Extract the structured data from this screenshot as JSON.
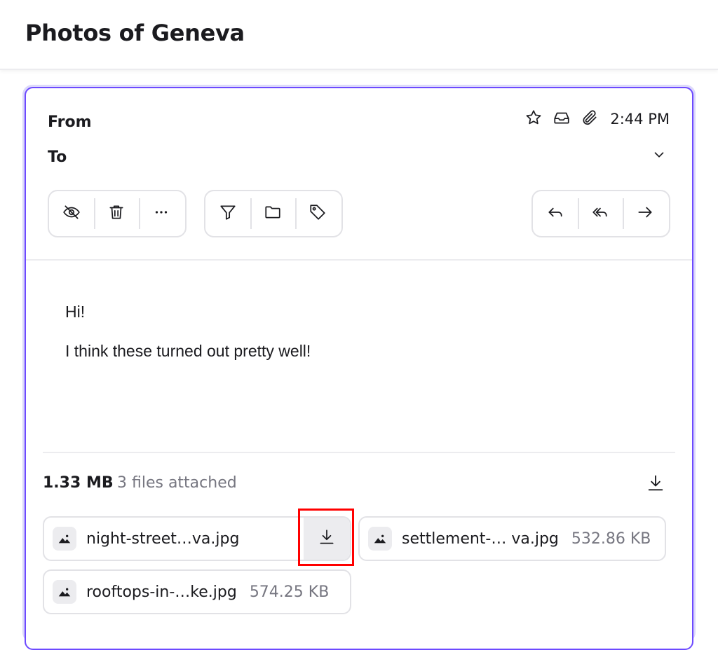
{
  "header": {
    "subject": "Photos of Geneva"
  },
  "message": {
    "from_label": "From",
    "to_label": "To",
    "time": "2:44 PM",
    "icons": [
      "star-icon",
      "inbox-icon",
      "paperclip-icon",
      "chevron-down-icon"
    ],
    "toolbar": {
      "left_group": [
        "eye-off-icon",
        "trash-icon",
        "more-icon"
      ],
      "middle_group": [
        "filter-icon",
        "folder-icon",
        "tag-icon"
      ],
      "right_group": [
        "reply-icon",
        "reply-all-icon",
        "forward-icon"
      ]
    },
    "body": {
      "greeting": "Hi!",
      "line": "I think these turned out pretty well!"
    },
    "attachments": {
      "total_size": "1.33 MB",
      "count_text": "3 files attached",
      "files": [
        {
          "name": "night-street…va.jpg",
          "size": ""
        },
        {
          "name": "settlement-… va.jpg",
          "size": "532.86 KB"
        },
        {
          "name": "rooftops-in-…ke.jpg",
          "size": "574.25 KB"
        }
      ]
    }
  },
  "colors": {
    "accent": "#6d4aff",
    "highlight": "#ff0000",
    "muted_text": "#767680"
  }
}
